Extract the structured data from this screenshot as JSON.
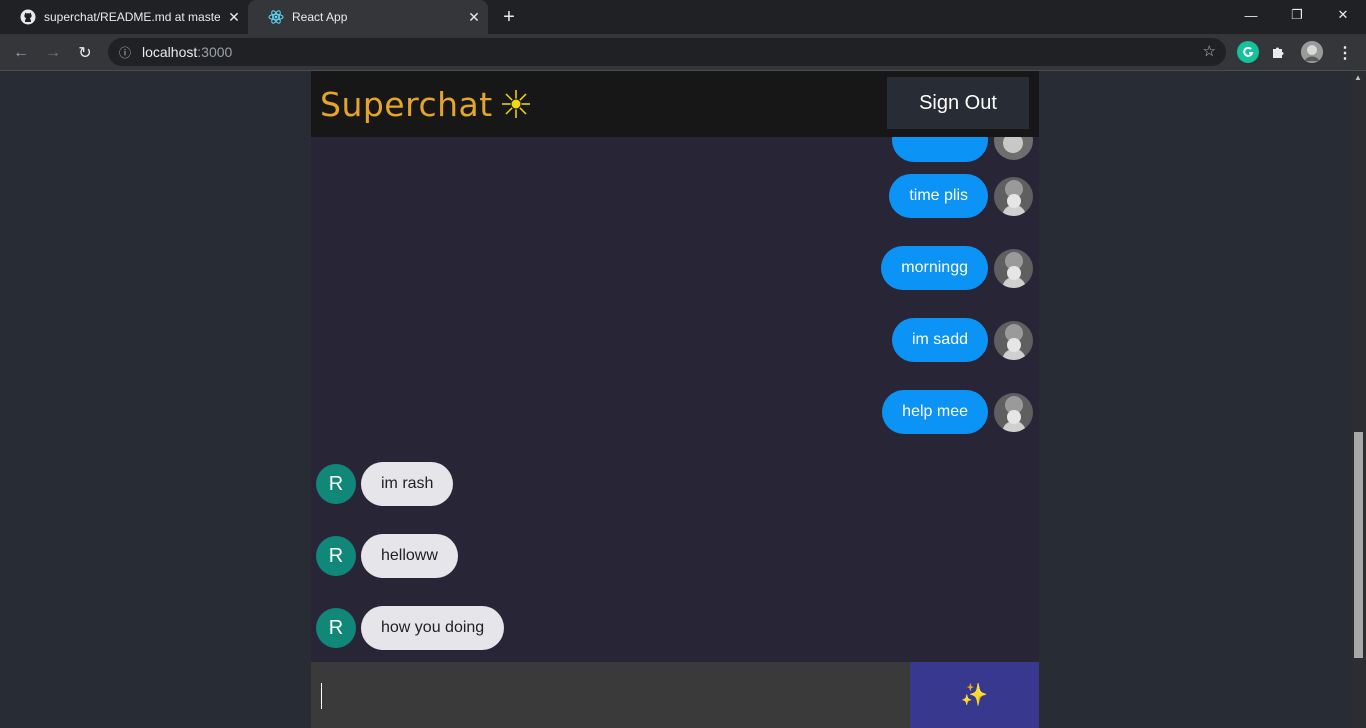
{
  "browser": {
    "tabs": [
      {
        "title": "superchat/README.md at master",
        "icon": "github-icon",
        "active": false
      },
      {
        "title": "React App",
        "icon": "react-icon",
        "active": true
      }
    ],
    "url_host": "localhost",
    "url_port": ":3000",
    "new_tab": "+",
    "tab_close": "✕",
    "window": {
      "minimize": "—",
      "restore": "❐",
      "close": "✕"
    },
    "nav": {
      "back": "←",
      "forward": "→",
      "reload": "↻",
      "info": "ⓘ",
      "star": "☆",
      "menu": "⋮"
    }
  },
  "app": {
    "brand": "Superchat",
    "sign_out_label": "Sign Out",
    "messages": [
      {
        "type": "sent",
        "text": "time plis"
      },
      {
        "type": "sent",
        "text": "morningg"
      },
      {
        "type": "sent",
        "text": "im sadd"
      },
      {
        "type": "sent",
        "text": "help mee"
      },
      {
        "type": "received",
        "avatar": "R",
        "text": "im rash"
      },
      {
        "type": "received",
        "avatar": "R",
        "text": "helloww"
      },
      {
        "type": "received",
        "avatar": "R",
        "text": "how you doing"
      }
    ],
    "input_value": "",
    "send_icon": "✨",
    "colors": {
      "brand": "#e4a52a",
      "sent_bubble": "#0b93f6",
      "received_bubble": "#e5e5ea",
      "avatar_letter_bg": "#11877a",
      "send_button": "#38388f"
    }
  }
}
